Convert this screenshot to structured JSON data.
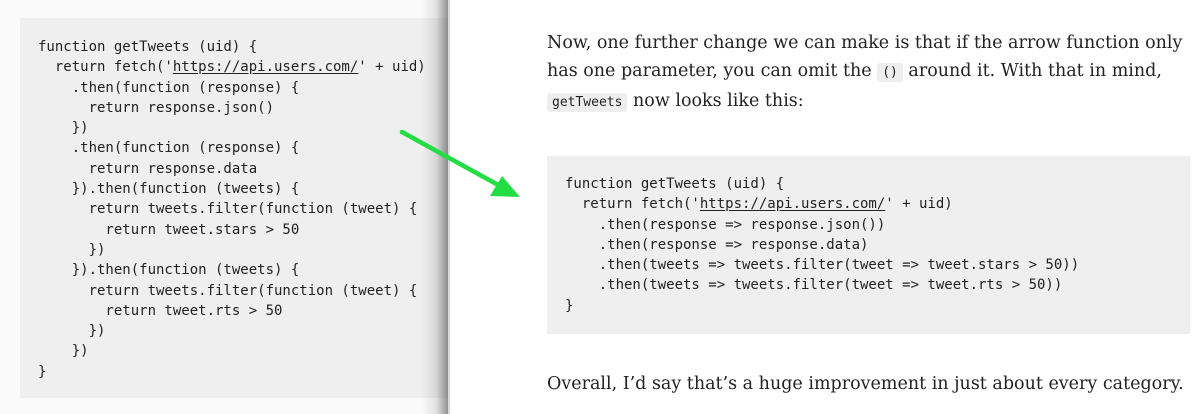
{
  "left_code": {
    "lines": [
      [
        "function getTweets (uid) {"
      ],
      [
        "  return fetch('",
        {
          "url": "https://api.users.com/"
        },
        "' + uid)"
      ],
      [
        "    .then(function (response) {"
      ],
      [
        "      return response.json()"
      ],
      [
        "    })"
      ],
      [
        "    .then(function (response) {"
      ],
      [
        "      return response.data"
      ],
      [
        "    }).then(function (tweets) {"
      ],
      [
        "      return tweets.filter(function (tweet) {"
      ],
      [
        "        return tweet.stars > 50"
      ],
      [
        "      })"
      ],
      [
        "    }).then(function (tweets) {"
      ],
      [
        "      return tweets.filter(function (tweet) {"
      ],
      [
        "        return tweet.rts > 50"
      ],
      [
        "      })"
      ],
      [
        "    })"
      ],
      [
        "}"
      ]
    ]
  },
  "right_code": {
    "lines": [
      [
        "function getTweets (uid) {"
      ],
      [
        "  return fetch('",
        {
          "url": "https://api.users.com/"
        },
        "' + uid)"
      ],
      [
        "    .then(response => response.json())"
      ],
      [
        "    .then(response => response.data)"
      ],
      [
        "    .then(tweets => tweets.filter(tweet => tweet.stars > 50))"
      ],
      [
        "    .then(tweets => tweets.filter(tweet => tweet.rts > 50))"
      ],
      [
        "}"
      ]
    ]
  },
  "para1": {
    "text_a": "Now, one further change we can make is that if the arrow function only has one parameter, you can omit the ",
    "code_a": "()",
    "text_b": " around it. With that in mind, ",
    "code_b": "getTweets",
    "text_c": " now looks like this:"
  },
  "para2": {
    "text": "Overall, I’d say that’s a huge improvement in just about every category."
  },
  "colors": {
    "arrow": "#22dd44",
    "code_background": "#efefef",
    "text": "#222222"
  },
  "icons": {
    "arrow": "green-arrow-icon"
  }
}
